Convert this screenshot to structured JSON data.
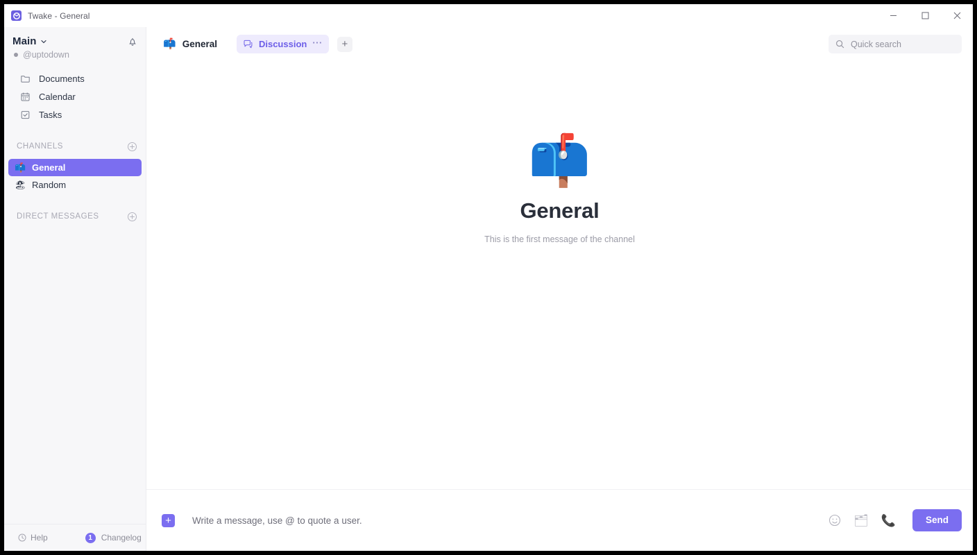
{
  "window": {
    "title": "Twake - General",
    "app_icon": "twake-logo-icon",
    "controls": {
      "minimize": "minimize-icon",
      "maximize": "maximize-icon",
      "close": "close-icon"
    }
  },
  "sidebar": {
    "workspace": {
      "name": "Main",
      "chevron": "chevron-down-icon",
      "user": "@uptodown",
      "bell": "bell-icon"
    },
    "nav": [
      {
        "label": "Documents",
        "icon": "folder-icon"
      },
      {
        "label": "Calendar",
        "icon": "calendar-icon"
      },
      {
        "label": "Tasks",
        "icon": "checkbox-icon"
      }
    ],
    "channels_section": {
      "title": "CHANNELS",
      "add": "plus-circle-icon",
      "items": [
        {
          "label": "General",
          "emoji": "📫",
          "active": true
        },
        {
          "label": "Random",
          "emoji": "🏖",
          "active": false
        }
      ]
    },
    "dm_section": {
      "title": "DIRECT MESSAGES",
      "add": "plus-circle-icon",
      "items": []
    },
    "footer": {
      "help_label": "Help",
      "help_icon": "help-circle-icon",
      "changelog_label": "Changelog",
      "changelog_count": "1"
    }
  },
  "topbar": {
    "channel_tab": {
      "label": "General",
      "emoji": "📫"
    },
    "app_tabs": [
      {
        "label": "Discussion",
        "icon": "chat-icon",
        "active": true,
        "menu": "···"
      }
    ],
    "add_tab": "+",
    "search": {
      "placeholder": "Quick search",
      "icon": "search-icon"
    }
  },
  "conversation": {
    "emoji": "📫",
    "title": "General",
    "subtitle": "This is the first message of the channel"
  },
  "composer": {
    "add_button": "+",
    "placeholder": "Write a message, use @ to quote a user.",
    "actions": [
      {
        "name": "emoji-icon",
        "glyph": "☺"
      },
      {
        "name": "file-icon",
        "glyph": "🗂"
      },
      {
        "name": "phone-icon",
        "glyph": "📞"
      }
    ],
    "send_label": "Send"
  },
  "colors": {
    "accent": "#7b6ef0",
    "tab_active_bg": "#eeebfd",
    "sidebar_bg": "#f7f7f9"
  }
}
